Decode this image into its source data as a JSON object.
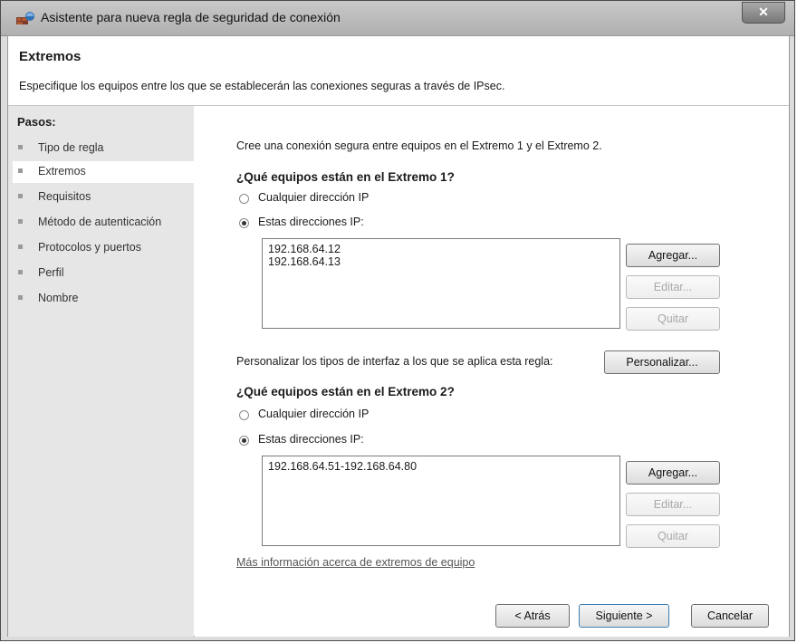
{
  "window": {
    "title": "Asistente para nueva regla de seguridad de conexión",
    "close_symbol": "✕"
  },
  "header": {
    "title": "Extremos",
    "description": "Especifique los equipos entre los que se establecerán las conexiones seguras a través de IPsec."
  },
  "steps": {
    "title": "Pasos:",
    "items": [
      {
        "label": "Tipo de regla"
      },
      {
        "label": "Extremos",
        "current": true
      },
      {
        "label": "Requisitos"
      },
      {
        "label": "Método de autenticación"
      },
      {
        "label": "Protocolos y puertos"
      },
      {
        "label": "Perfil"
      },
      {
        "label": "Nombre"
      }
    ]
  },
  "main": {
    "intro": "Cree una conexión segura entre equipos en el Extremo 1 y el Extremo 2.",
    "endpoint1": {
      "heading": "¿Qué equipos están en el Extremo 1?",
      "option_any": "Cualquier dirección IP",
      "option_these": "Estas direcciones IP:",
      "selected": "these",
      "addresses": [
        "192.168.64.12",
        "192.168.64.13"
      ],
      "add_label": "Agregar...",
      "edit_label": "Editar...",
      "remove_label": "Quitar"
    },
    "customize_text": "Personalizar los tipos de interfaz a los que se aplica esta regla:",
    "customize_label": "Personalizar...",
    "endpoint2": {
      "heading": "¿Qué equipos están en el Extremo 2?",
      "option_any": "Cualquier dirección IP",
      "option_these": "Estas direcciones IP:",
      "selected": "these",
      "addresses": [
        "192.168.64.51-192.168.64.80"
      ],
      "add_label": "Agregar...",
      "edit_label": "Editar...",
      "remove_label": "Quitar"
    },
    "more_info_link": "Más información acerca de extremos de equipo"
  },
  "footer": {
    "back_label": "< Atrás",
    "next_label": "Siguiente >",
    "cancel_label": "Cancelar"
  },
  "icons": {
    "app": "firewall-shield-icon",
    "close": "close-icon",
    "step_bullet": "step-bullet-icon"
  }
}
